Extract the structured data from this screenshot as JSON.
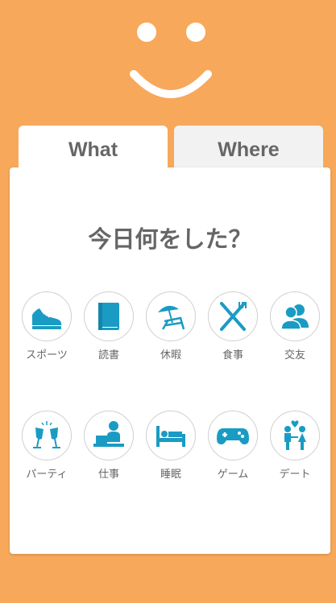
{
  "colors": {
    "background": "#F7A85A",
    "icon": "#1A9BC4",
    "text": "#666666"
  },
  "header": {
    "mascot": "smiley-face-icon"
  },
  "tabs": [
    {
      "label": "What",
      "active": true
    },
    {
      "label": "Where",
      "active": false
    }
  ],
  "question": "今日何をした？",
  "activities": [
    {
      "label": "スポーツ",
      "icon": "sneaker-icon"
    },
    {
      "label": "読書",
      "icon": "book-icon"
    },
    {
      "label": "休暇",
      "icon": "beach-chair-icon"
    },
    {
      "label": "食事",
      "icon": "fork-knife-icon"
    },
    {
      "label": "交友",
      "icon": "friends-icon"
    },
    {
      "label": "パーティ",
      "icon": "champagne-glasses-icon"
    },
    {
      "label": "仕事",
      "icon": "office-worker-icon"
    },
    {
      "label": "睡眠",
      "icon": "bed-icon"
    },
    {
      "label": "ゲーム",
      "icon": "gamepad-icon"
    },
    {
      "label": "デート",
      "icon": "couple-heart-icon"
    }
  ]
}
